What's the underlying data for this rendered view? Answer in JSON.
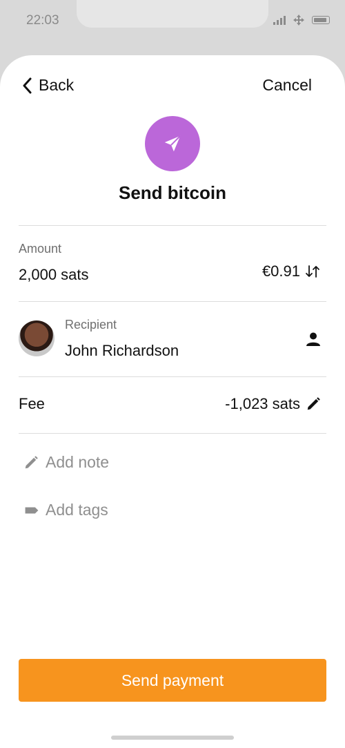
{
  "status_bar": {
    "time": "22:03"
  },
  "nav": {
    "back_label": "Back",
    "cancel_label": "Cancel"
  },
  "header": {
    "title": "Send bitcoin"
  },
  "amount": {
    "label": "Amount",
    "value": "2,000 sats",
    "fiat_value": "€0.91"
  },
  "recipient": {
    "label": "Recipient",
    "name": "John Richardson"
  },
  "fee": {
    "label": "Fee",
    "value": "-1,023 sats"
  },
  "actions": {
    "add_note": "Add note",
    "add_tags": "Add tags"
  },
  "primary_button": {
    "label": "Send payment"
  },
  "colors": {
    "accent_purple": "#bb67d9",
    "primary_orange": "#f7941e"
  }
}
